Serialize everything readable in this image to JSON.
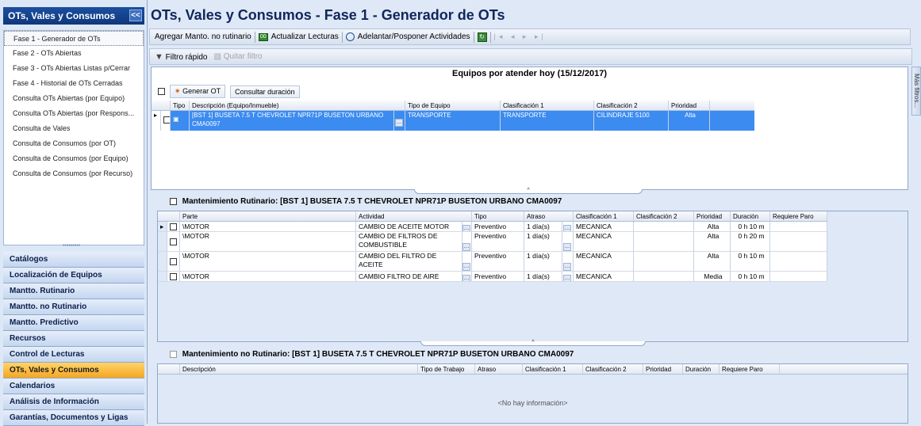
{
  "sidebar": {
    "title": "OTs, Vales y Consumos",
    "collapse_glyph": "<<",
    "items": [
      {
        "label": "Fase 1 - Generador de OTs",
        "selected": true
      },
      {
        "label": "Fase 2 - OTs Abiertas"
      },
      {
        "label": "Fase 3 - OTs Abiertas Listas p/Cerrar"
      },
      {
        "label": "Fase 4 - Historial de OTs Cerradas"
      },
      {
        "label": "Consulta OTs Abiertas (por Equipo)"
      },
      {
        "label": "Consulta OTs Abiertas (por Respons..."
      },
      {
        "label": "Consulta de Vales"
      },
      {
        "label": "Consulta de Consumos (por OT)"
      },
      {
        "label": "Consulta de Consumos (por Equipo)"
      },
      {
        "label": "Consulta de Consumos (por Recurso)"
      }
    ],
    "groups": [
      {
        "label": "Catálogos"
      },
      {
        "label": "Localización de Equipos"
      },
      {
        "label": "Mantto. Rutinario"
      },
      {
        "label": "Mantto. no Rutinario"
      },
      {
        "label": "Mantto. Predictivo"
      },
      {
        "label": "Recursos"
      },
      {
        "label": "Control de Lecturas"
      },
      {
        "label": "OTs, Vales y Consumos",
        "active": true
      },
      {
        "label": "Calendarios"
      },
      {
        "label": "Análisis de Información"
      },
      {
        "label": "Garantías, Documentos y Ligas"
      }
    ]
  },
  "main": {
    "title": "OTs, Vales y Consumos - Fase 1 - Generador de OTs",
    "toolbar": {
      "agregar": "Agregar Manto. no rutinario",
      "actualizar": "Actualizar Lecturas",
      "adelantar": "Adelantar/Posponer Actividades"
    },
    "filter_bar": {
      "filtro": "Filtro rápido",
      "quitar": "Quitar filtro"
    },
    "right_tab": "Más filtros..."
  },
  "equipos": {
    "title": "Equipos por atender hoy (15/12/2017)",
    "btn_generar": "Generar OT",
    "btn_consultar": "Consultar duración",
    "columns": [
      "Tipo",
      "Descripción (Equipo/Inmueble)",
      "Tipo de Equipo",
      "Clasificación 1",
      "Clasificación 2",
      "Prioridad"
    ],
    "rows": [
      {
        "desc": "[BST 1] BUSETA 7.5 T CHEVROLET NPR71P BUSETON URBANO CMA0097",
        "tipo_equipo": "TRANSPORTE",
        "clas1": "TRANSPORTE",
        "clas2": "CILINDRAJE 5100",
        "prioridad": "Alta"
      }
    ]
  },
  "rutinario": {
    "title": "Mantenimiento Rutinario: [BST 1] BUSETA 7.5 T CHEVROLET NPR71P BUSETON URBANO CMA0097",
    "columns": [
      "Parte",
      "Actividad",
      "Tipo",
      "Atraso",
      "Clasificación 1",
      "Clasificación 2",
      "Prioridad",
      "Duración",
      "Requiere Paro"
    ],
    "rows": [
      {
        "parte": "\\MOTOR",
        "actividad": "CAMBIO DE ACEITE MOTOR",
        "tipo": "Preventivo",
        "atraso": "1 día(s)",
        "clas1": "MECANICA",
        "clas2": "",
        "prioridad": "Alta",
        "duracion": "0 h 10 m",
        "paro": ""
      },
      {
        "parte": "\\MOTOR",
        "actividad": "CAMBIO DE FILTROS DE COMBUSTIBLE",
        "tipo": "Preventivo",
        "atraso": "1 día(s)",
        "clas1": "MECANICA",
        "clas2": "",
        "prioridad": "Alta",
        "duracion": "0 h 20 m",
        "paro": ""
      },
      {
        "parte": "\\MOTOR",
        "actividad": "CAMBIO DEL FILTRO DE ACEITE",
        "tipo": "Preventivo",
        "atraso": "1 día(s)",
        "clas1": "MECANICA",
        "clas2": "",
        "prioridad": "Alta",
        "duracion": "0 h 10 m",
        "paro": ""
      },
      {
        "parte": "\\MOTOR",
        "actividad": "CAMBIO FILTRO DE AIRE",
        "tipo": "Preventivo",
        "atraso": "1 día(s)",
        "clas1": "MECANICA",
        "clas2": "",
        "prioridad": "Media",
        "duracion": "0 h 10 m",
        "paro": ""
      }
    ]
  },
  "no_rutinario": {
    "title": "Mantenimiento no Rutinario: [BST 1] BUSETA 7.5 T CHEVROLET NPR71P BUSETON URBANO CMA0097",
    "columns": [
      "Descripción",
      "Tipo de Trabajo",
      "Atraso",
      "Clasificación 1",
      "Clasificación 2",
      "Prioridad",
      "Duración",
      "Requiere Paro"
    ],
    "empty": "<No hay información>"
  }
}
